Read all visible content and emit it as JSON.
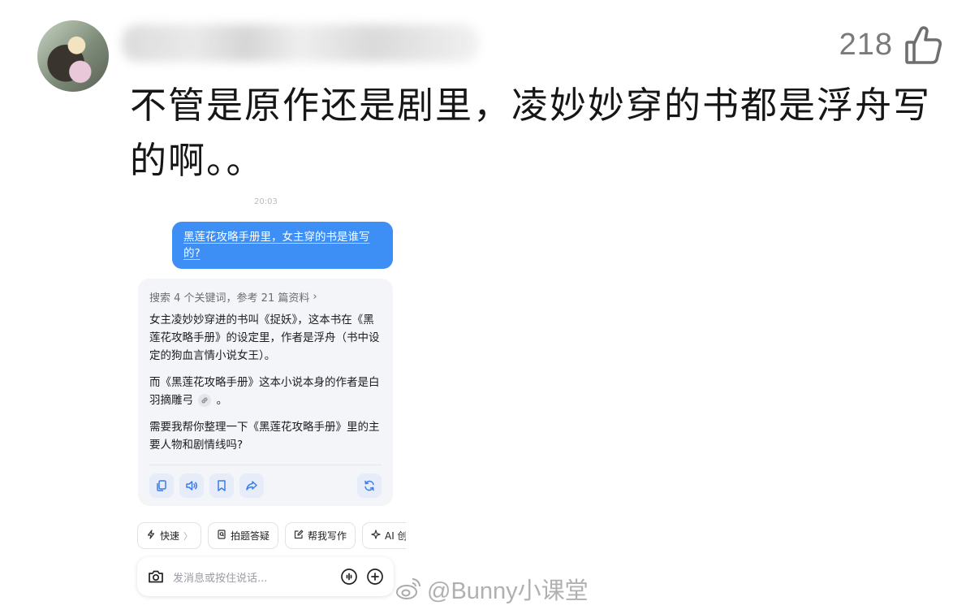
{
  "post": {
    "like_count": "218",
    "comment_text": "不管是原作还是剧里，凌妙妙穿的书都是浮舟写的啊。。",
    "icons": {
      "like": "thumbs-up-icon",
      "avatar": "avatar"
    }
  },
  "screenshot": {
    "timestamp": "20:03",
    "user_message": "黑莲花攻略手册里，女主穿的书是谁写的?",
    "search_meta": "搜索 4 个关键词，参考 21 篇资料",
    "answer_p1": "女主凌妙妙穿进的书叫《捉妖》，这本书在《黑莲花攻略手册》的设定里，作者是浮舟（书中设定的狗血言情小说女王）。",
    "answer_p2_text": "而《黑莲花攻略手册》这本小说本身的作者是白羽摘雕弓",
    "answer_p2_end": "。",
    "answer_p3": "需要我帮你整理一下《黑莲花攻略手册》里的主要人物和剧情线吗?",
    "action_icons": [
      "copy-icon",
      "speaker-icon",
      "bookmark-icon",
      "share-icon",
      "refresh-icon"
    ],
    "chips": [
      {
        "icon": "lightning-icon",
        "label": "快速"
      },
      {
        "icon": "photo-question-icon",
        "label": "拍题答疑"
      },
      {
        "icon": "edit-icon",
        "label": "帮我写作"
      },
      {
        "icon": "sparkle-icon",
        "label": "AI 创作"
      }
    ],
    "composer": {
      "placeholder": "发消息或按住说话..."
    }
  },
  "watermark": "@Bunny小课堂",
  "colors": {
    "user_bubble": "#3d8ff5",
    "ai_card_bg": "#f4f5f8",
    "action_btn_bg": "#e6edf9",
    "action_icon": "#3d7be8"
  }
}
